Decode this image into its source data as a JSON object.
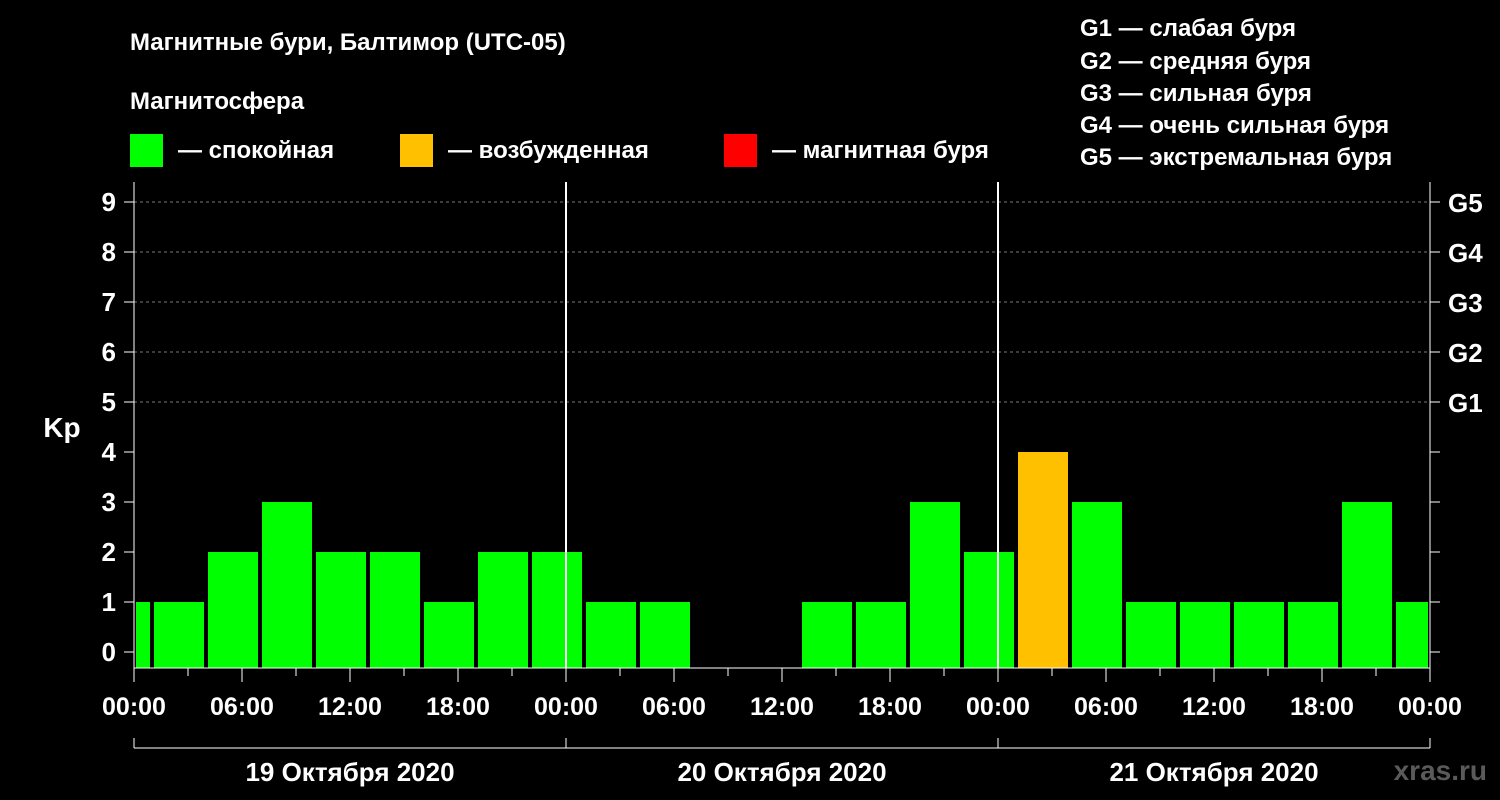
{
  "title": "Магнитные бури, Балтимор (UTC-05)",
  "magnetosphere_label": "Магнитосфера",
  "legend": [
    {
      "label": "— спокойная",
      "color": "#00ff00"
    },
    {
      "label": "— возбужденная",
      "color": "#ffc000"
    },
    {
      "label": "— магнитная буря",
      "color": "#ff0000"
    }
  ],
  "storm_scale": [
    "G1 — слабая буря",
    "G2 — средняя буря",
    "G3 — сильная буря",
    "G4 — очень сильная буря",
    "G5 — экстремальная буря"
  ],
  "watermark": "xras.ru",
  "chart_data": {
    "type": "bar",
    "ylabel": "Kp",
    "ylim": [
      0,
      9
    ],
    "yticks": [
      0,
      1,
      2,
      3,
      4,
      5,
      6,
      7,
      8,
      9
    ],
    "right_axis_labels": [
      {
        "kp": 5,
        "label": "G1"
      },
      {
        "kp": 6,
        "label": "G2"
      },
      {
        "kp": 7,
        "label": "G3"
      },
      {
        "kp": 8,
        "label": "G4"
      },
      {
        "kp": 9,
        "label": "G5"
      }
    ],
    "grid": "dashed horizontal at Kp 5-9",
    "x_tick_labels": [
      "00:00",
      "06:00",
      "12:00",
      "18:00",
      "00:00",
      "06:00",
      "12:00",
      "18:00",
      "00:00",
      "06:00",
      "12:00",
      "18:00",
      "00:00"
    ],
    "days": [
      "19 Октября 2020",
      "20 Октября 2020",
      "21 Октября 2020"
    ],
    "bars": [
      {
        "start_hour": 0,
        "end_hour": 1,
        "kp": 1,
        "level": "quiet"
      },
      {
        "start_hour": 1,
        "end_hour": 4,
        "kp": 1,
        "level": "quiet"
      },
      {
        "start_hour": 4,
        "end_hour": 7,
        "kp": 2,
        "level": "quiet"
      },
      {
        "start_hour": 7,
        "end_hour": 10,
        "kp": 3,
        "level": "quiet"
      },
      {
        "start_hour": 10,
        "end_hour": 13,
        "kp": 2,
        "level": "quiet"
      },
      {
        "start_hour": 13,
        "end_hour": 16,
        "kp": 2,
        "level": "quiet"
      },
      {
        "start_hour": 16,
        "end_hour": 19,
        "kp": 1,
        "level": "quiet"
      },
      {
        "start_hour": 19,
        "end_hour": 22,
        "kp": 2,
        "level": "quiet"
      },
      {
        "start_hour": 22,
        "end_hour": 25,
        "kp": 2,
        "level": "quiet"
      },
      {
        "start_hour": 25,
        "end_hour": 28,
        "kp": 1,
        "level": "quiet"
      },
      {
        "start_hour": 28,
        "end_hour": 31,
        "kp": 1,
        "level": "quiet"
      },
      {
        "start_hour": 31,
        "end_hour": 34,
        "kp": 0,
        "level": "quiet"
      },
      {
        "start_hour": 34,
        "end_hour": 37,
        "kp": 0,
        "level": "quiet"
      },
      {
        "start_hour": 37,
        "end_hour": 40,
        "kp": 1,
        "level": "quiet"
      },
      {
        "start_hour": 40,
        "end_hour": 43,
        "kp": 1,
        "level": "quiet"
      },
      {
        "start_hour": 43,
        "end_hour": 46,
        "kp": 3,
        "level": "quiet"
      },
      {
        "start_hour": 46,
        "end_hour": 49,
        "kp": 2,
        "level": "quiet"
      },
      {
        "start_hour": 49,
        "end_hour": 52,
        "kp": 4,
        "level": "active"
      },
      {
        "start_hour": 52,
        "end_hour": 55,
        "kp": 3,
        "level": "quiet"
      },
      {
        "start_hour": 55,
        "end_hour": 58,
        "kp": 1,
        "level": "quiet"
      },
      {
        "start_hour": 58,
        "end_hour": 61,
        "kp": 1,
        "level": "quiet"
      },
      {
        "start_hour": 61,
        "end_hour": 64,
        "kp": 1,
        "level": "quiet"
      },
      {
        "start_hour": 64,
        "end_hour": 67,
        "kp": 1,
        "level": "quiet"
      },
      {
        "start_hour": 67,
        "end_hour": 70,
        "kp": 3,
        "level": "quiet"
      },
      {
        "start_hour": 70,
        "end_hour": 72,
        "kp": 1,
        "level": "quiet"
      }
    ],
    "colors": {
      "quiet": "#00ff00",
      "active": "#ffc000",
      "storm": "#ff0000"
    }
  }
}
